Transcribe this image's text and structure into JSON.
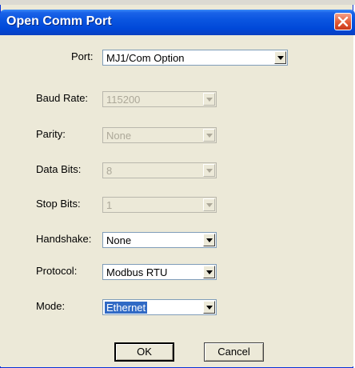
{
  "window": {
    "title": "Open Comm Port"
  },
  "colors": {
    "title_bar": "#0a55e0",
    "dialog_bg": "#ece9d8",
    "selection": "#316ac5",
    "close_button": "#e35a34"
  },
  "icons": {
    "close": "close-icon",
    "dropdown": "chevron-down-icon"
  },
  "fields": {
    "port": {
      "label": "Port:",
      "value": "MJ1/Com Option",
      "enabled": true
    },
    "baud_rate": {
      "label": "Baud Rate:",
      "value": "115200",
      "enabled": false
    },
    "parity": {
      "label": "Parity:",
      "value": "None",
      "enabled": false
    },
    "data_bits": {
      "label": "Data Bits:",
      "value": "8",
      "enabled": false
    },
    "stop_bits": {
      "label": "Stop Bits:",
      "value": "1",
      "enabled": false
    },
    "handshake": {
      "label": "Handshake:",
      "value": "None",
      "enabled": true
    },
    "protocol": {
      "label": "Protocol:",
      "value": "Modbus RTU",
      "enabled": true
    },
    "mode": {
      "label": "Mode:",
      "value": "Ethernet",
      "enabled": true,
      "selected": true
    }
  },
  "buttons": {
    "ok": "OK",
    "cancel": "Cancel"
  }
}
